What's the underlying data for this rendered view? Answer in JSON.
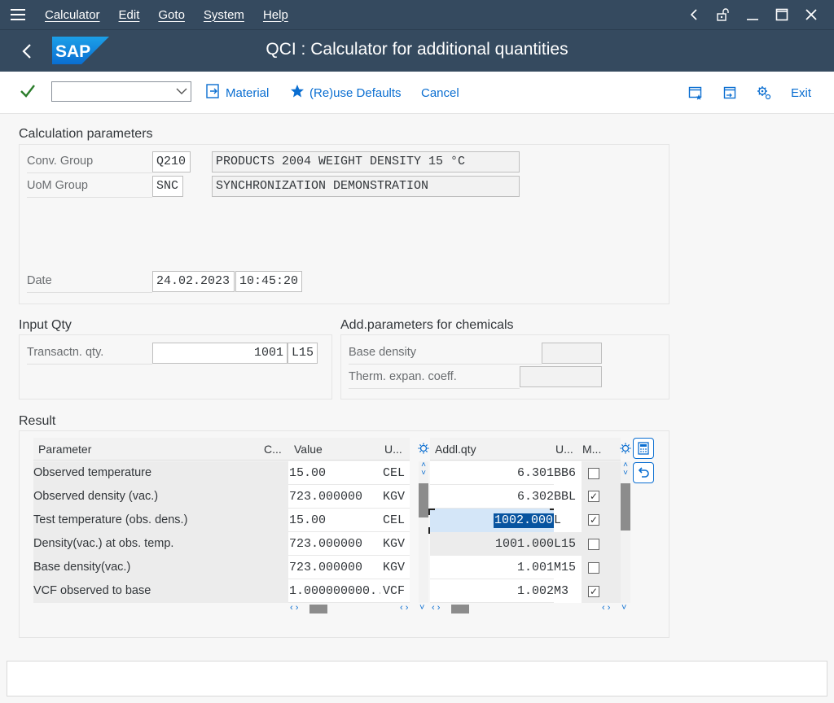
{
  "menu": [
    "Calculator",
    "Edit",
    "Goto",
    "System",
    "Help"
  ],
  "title": "QCI : Calculator for additional quantities",
  "logo_text": "SAP",
  "toolbar": {
    "material_label": "Material",
    "reuse_label": "(Re)use Defaults",
    "cancel_label": "Cancel",
    "exit_label": "Exit"
  },
  "calc_params": {
    "title": "Calculation parameters",
    "conv_group_label": "Conv. Group",
    "conv_group_value": "Q210",
    "conv_group_desc": "PRODUCTS 2004 WEIGHT DENSITY 15 °C",
    "uom_group_label": "UoM Group",
    "uom_group_value": "SNC",
    "uom_group_desc": "SYNCHRONIZATION DEMONSTRATION",
    "date_label": "Date",
    "date_value": "24.02.2023",
    "time_value": "10:45:20"
  },
  "input_qty": {
    "title": "Input Qty",
    "label": "Transactn. qty.",
    "value": "1001",
    "unit": "L15"
  },
  "chem_params": {
    "title": "Add.parameters for chemicals",
    "base_density_label": "Base density",
    "therm_label": "Therm. expan. coeff."
  },
  "result": {
    "title": "Result",
    "left_headers": {
      "parameter": "Parameter",
      "c": "C...",
      "value": "Value",
      "unit": "U..."
    },
    "right_headers": {
      "addl": "Addl.qty",
      "unit": "U...",
      "m": "M..."
    },
    "rows": [
      {
        "param": "Observed temperature",
        "value": "15.00",
        "unit": "CEL"
      },
      {
        "param": "Observed density (vac.)",
        "value": "723.000000",
        "unit": "KGV"
      },
      {
        "param": "Test temperature (obs. dens.)",
        "value": "15.00",
        "unit": "CEL"
      },
      {
        "param": "Density(vac.) at obs. temp.",
        "value": "723.000000",
        "unit": "KGV"
      },
      {
        "param": "Base density(vac.)",
        "value": "723.000000",
        "unit": "KGV"
      },
      {
        "param": "VCF observed to base",
        "value": "1.000000000...",
        "unit": "VCF"
      }
    ],
    "addl_rows": [
      {
        "qty": "6.301",
        "unit": "BB6",
        "checked": false
      },
      {
        "qty": "6.302",
        "unit": "BBL",
        "checked": true
      },
      {
        "qty": "1002.000",
        "unit": "L",
        "checked": true
      },
      {
        "qty": "1001.000",
        "unit": "L15",
        "checked": false
      },
      {
        "qty": "1.001",
        "unit": "M15",
        "checked": false
      },
      {
        "qty": "1.002",
        "unit": "M3",
        "checked": true
      }
    ]
  },
  "colors": {
    "shell": "#354a5f",
    "accent": "#0a6ed1",
    "selection": "#0854a0"
  }
}
